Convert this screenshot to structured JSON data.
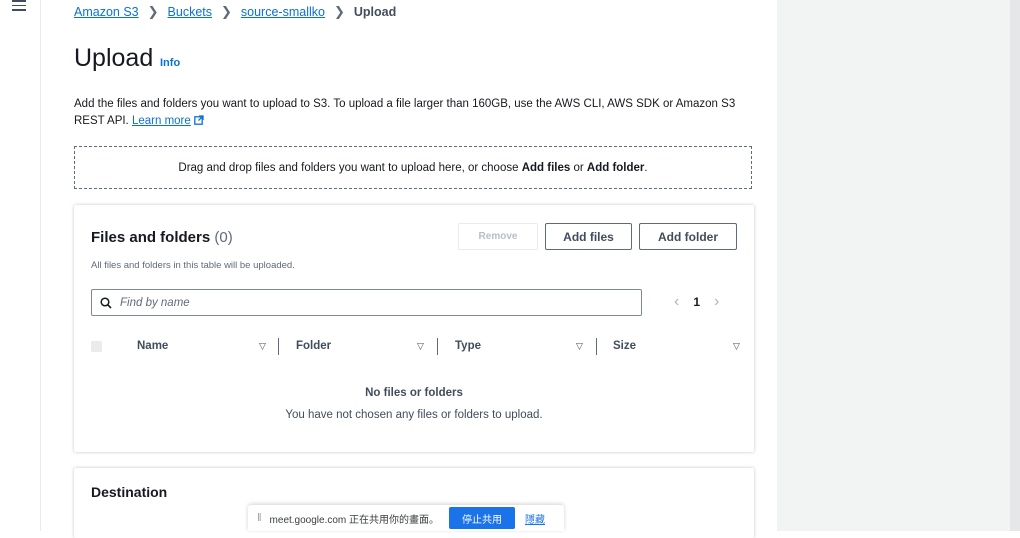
{
  "nav": {
    "menu_icon": "hamburger-menu-icon"
  },
  "breadcrumb": {
    "items": [
      "Amazon S3",
      "Buckets",
      "source-smallko"
    ],
    "current": "Upload"
  },
  "header": {
    "title": "Upload",
    "info": "Info"
  },
  "description": {
    "text": "Add the files and folders you want to upload to S3. To upload a file larger than 160GB, use the AWS CLI, AWS SDK or Amazon S3 REST API.",
    "link": "Learn more",
    "link_icon": "external-link-icon"
  },
  "dropzone": {
    "prefix": "Drag and drop files and folders you want to upload here, or choose",
    "add_files": "Add files",
    "or": "or",
    "add_folder": "Add folder",
    "suffix": "."
  },
  "files_panel": {
    "title": "Files and folders",
    "count": "(0)",
    "subtitle": "All files and folders in this table will be uploaded.",
    "buttons": {
      "remove": "Remove",
      "add_files": "Add files",
      "add_folder": "Add folder"
    },
    "search": {
      "placeholder": "Find by name",
      "value": ""
    },
    "pagination": {
      "page": "1"
    },
    "columns": [
      "Name",
      "Folder",
      "Type",
      "Size"
    ],
    "empty": {
      "title": "No files or folders",
      "message": "You have not chosen any files or folders to upload."
    }
  },
  "destination_panel": {
    "title": "Destination"
  },
  "share_bar": {
    "text": "meet.google.com 正在共用你的畫面。",
    "stop_button": "停止共用",
    "hide_link": "隱藏"
  },
  "colors": {
    "link": "#0972d3",
    "share_button": "#1a73e8"
  }
}
